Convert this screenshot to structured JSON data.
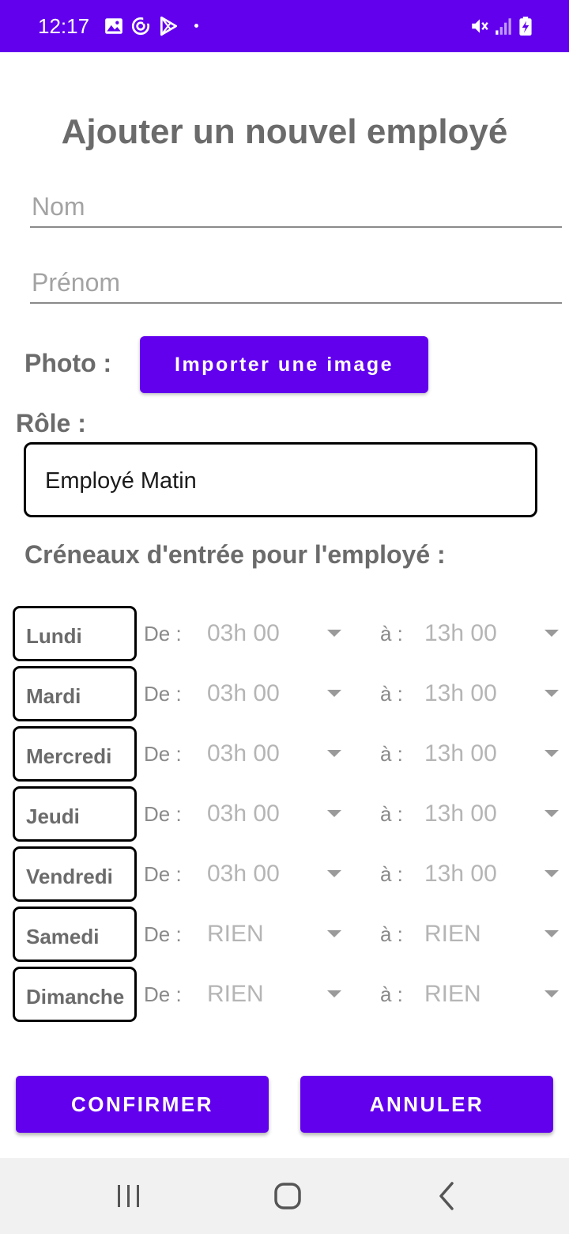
{
  "status_bar": {
    "time": "12:17",
    "left_icons": [
      "image-icon",
      "sync-icon",
      "play-store-icon"
    ],
    "right_icons": [
      "mute-icon",
      "signal-icon",
      "battery-charging-icon"
    ],
    "background": "#6200ee"
  },
  "form": {
    "title": "Ajouter un nouvel employé",
    "nom_placeholder": "Nom",
    "prenom_placeholder": "Prénom",
    "photo_label": "Photo :",
    "import_button_label": "Importer une image",
    "role_label": "Rôle :",
    "role_value": "Employé Matin",
    "slots_heading": "Créneaux d'entrée pour l'employé :",
    "from_label": "De :",
    "to_label": "à :"
  },
  "schedule": [
    {
      "day": "Lundi",
      "from": "03h 00",
      "to": "13h 00"
    },
    {
      "day": "Mardi",
      "from": "03h 00",
      "to": "13h 00"
    },
    {
      "day": "Mercredi",
      "from": "03h 00",
      "to": "13h 00"
    },
    {
      "day": "Jeudi",
      "from": "03h 00",
      "to": "13h 00"
    },
    {
      "day": "Vendredi",
      "from": "03h 00",
      "to": "13h 00"
    },
    {
      "day": "Samedi",
      "from": "RIEN",
      "to": "RIEN"
    },
    {
      "day": "Dimanche",
      "from": "RIEN",
      "to": "RIEN"
    }
  ],
  "actions": {
    "confirm_label": "CONFIRMER",
    "cancel_label": "ANNULER"
  },
  "nav_bar": {
    "icons": [
      "recents-icon",
      "home-icon",
      "back-icon"
    ]
  },
  "colors": {
    "accent": "#6200ee",
    "label_gray": "#6b6b6b",
    "spinner_text": "#b5b5b5"
  }
}
